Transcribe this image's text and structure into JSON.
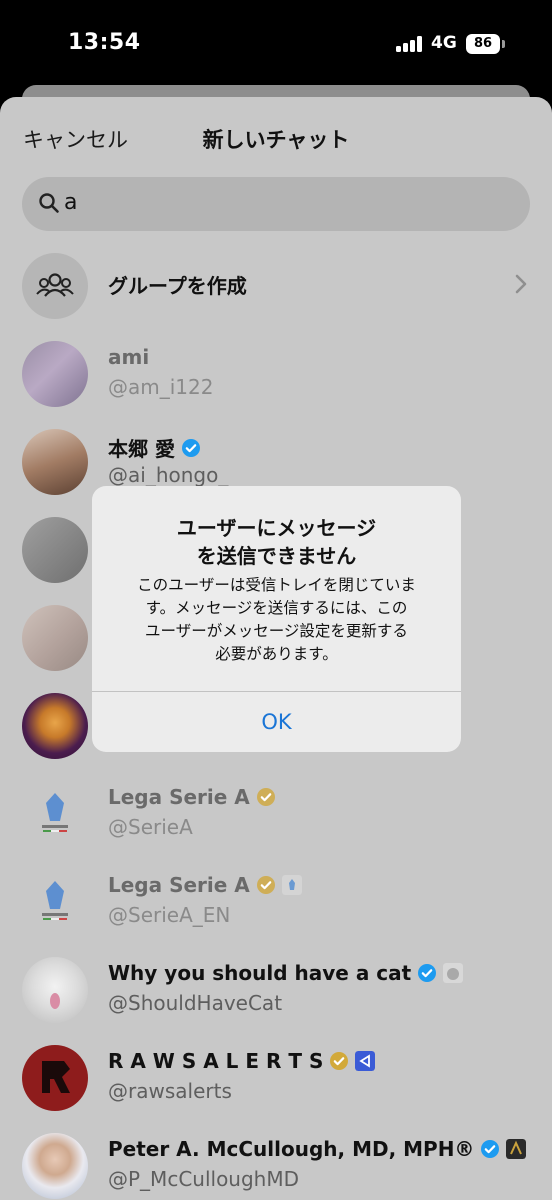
{
  "status_bar": {
    "time": "13:54",
    "network": "4G",
    "battery": "86"
  },
  "header": {
    "cancel_label": "キャンセル",
    "title": "新しいチャット"
  },
  "search": {
    "value": "a"
  },
  "create_group": {
    "label": "グループを作成"
  },
  "users": [
    {
      "name": "ami",
      "handle": "@am_i122",
      "verified": "none"
    },
    {
      "name": "本郷 愛",
      "handle": "@ai_hongo_",
      "verified": "blue"
    },
    {
      "name": "",
      "handle": ""
    },
    {
      "name": "",
      "handle": ""
    },
    {
      "name": "",
      "handle": ""
    },
    {
      "name": "Lega Serie A",
      "handle": "@SerieA",
      "verified": "gold"
    },
    {
      "name": "Lega Serie A",
      "handle": "@SerieA_EN",
      "verified": "gold"
    },
    {
      "name": "Why you should have a cat",
      "handle": "@ShouldHaveCat",
      "verified": "blue"
    },
    {
      "name": "R A W S A L E R T S",
      "handle": "@rawsalerts",
      "verified": "gold"
    },
    {
      "name": "Peter A. McCullough, MD, MPH®",
      "handle": "@P_McCulloughMD",
      "verified": "blue"
    }
  ],
  "alert": {
    "title_line1": "ユーザーにメッセージ",
    "title_line2": "を送信できません",
    "message_line1": "このユーザーは受信トレイを閉じていま",
    "message_line2": "す。メッセージを送信するには、この",
    "message_line3": "ユーザーがメッセージ設定を更新する",
    "message_line4": "必要があります。",
    "ok_label": "OK"
  },
  "colors": {
    "accent": "#1a75d6",
    "verified_blue": "#1d9bf0",
    "verified_gold": "#d8b24a",
    "sheet": "#c8c8c8"
  }
}
